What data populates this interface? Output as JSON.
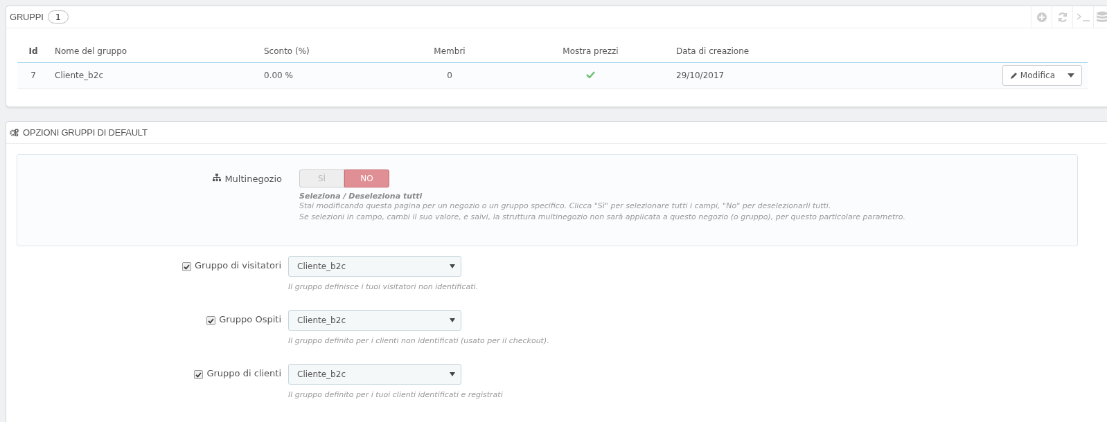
{
  "groups_panel": {
    "title": "GRUPPI",
    "count": "1",
    "table": {
      "columns": [
        "Id",
        "Nome del gruppo",
        "Sconto (%)",
        "Membri",
        "Mostra prezzi",
        "Data di creazione"
      ],
      "rows": [
        {
          "id": "7",
          "name": "Cliente_b2c",
          "discount": "0.00 %",
          "members": "0",
          "show_prices": true,
          "date": "29/10/2017",
          "action": "Modifica"
        }
      ]
    }
  },
  "options_panel": {
    "title": "OPZIONI GRUPPI DI DEFAULT",
    "multistore": {
      "label": "Multinegozio",
      "options": [
        {
          "label": "SÌ",
          "selected": false
        },
        {
          "label": "NO",
          "selected": true
        }
      ],
      "help_title": "Seleziona / Deseleziona tutti",
      "help_lines": [
        "Stai modificando questa pagina per un negozio o un gruppo specifico. Clicca \"Sì\" per selezionare tutti i campi, \"No\" per deselezionarli tutti.",
        "Se selezioni in campo, cambi il suo valore, e salvi, la struttura multinegozio non sarà applicata a questo negozio (o gruppo), per questo particolare parametro."
      ]
    },
    "fields": [
      {
        "label": "Gruppo di visitatori",
        "checked": true,
        "value": "Cliente_b2c",
        "help": "Il gruppo definisce i tuoi visitatori non identificati."
      },
      {
        "label": "Gruppo Ospiti",
        "checked": true,
        "value": "Cliente_b2c",
        "help": "Il gruppo definito per i clienti non identificati (usato per il checkout)."
      },
      {
        "label": "Gruppo di clienti",
        "checked": true,
        "value": "Cliente_b2c",
        "help": "Il gruppo definito per i tuoi clienti identificati e registrati"
      }
    ]
  }
}
